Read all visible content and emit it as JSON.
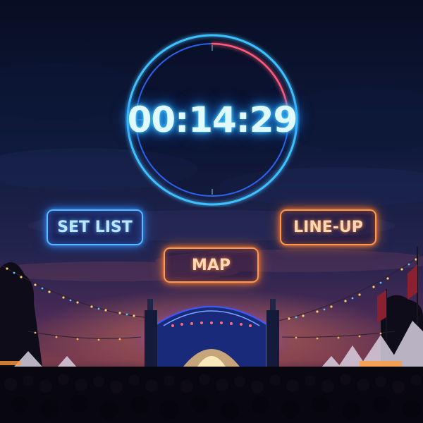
{
  "timer": {
    "display": "00:14:29",
    "progress": 0.24
  },
  "buttons": {
    "set_list": "SET LIST",
    "line_up": "LINE-UP",
    "map": "MAP"
  },
  "colors": {
    "timer_glow": "#3fbfff",
    "timer_accent": "#ff5a7a",
    "button_blue": "#59b8ff",
    "button_orange": "#ff9a4d"
  }
}
